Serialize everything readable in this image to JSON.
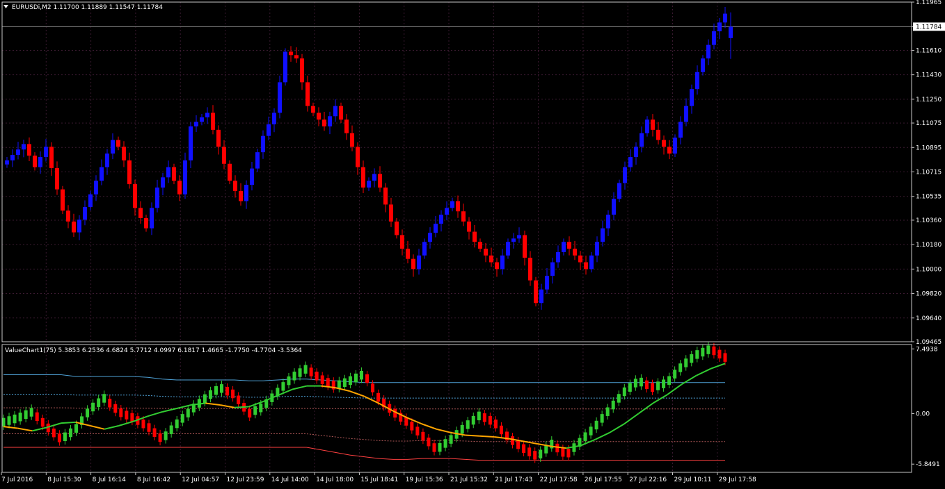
{
  "window": {
    "symbol_header": "EURUSDi,M2  1.11700 1.11889 1.11547 1.11784",
    "menu_icon": "triangle-down-icon"
  },
  "colors": {
    "background": "#000000",
    "grid": "#3a1a30",
    "frame": "#c8c8c8",
    "bull": "#1010ff",
    "bear": "#ff0000",
    "price_line": "#808080",
    "osc_bull": "#32cd32",
    "osc_bear": "#ff0000",
    "ma_up": "#32cd32",
    "ma_down": "#ffa500",
    "upper_band": "#4fa3d8",
    "lower_band": "#ff4040",
    "mid_band": "#b05858"
  },
  "chart_data": [
    {
      "type": "candlestick",
      "title": "EURUSDi,M2  1.11700 1.11889 1.11547 1.11784",
      "y_ticks": [
        "1.11965",
        "1.11784",
        "1.11610",
        "1.11430",
        "1.11250",
        "1.11075",
        "1.10895",
        "1.10715",
        "1.10535",
        "1.10360",
        "1.10180",
        "1.10000",
        "1.09820",
        "1.09640",
        "1.09465"
      ],
      "ylim": [
        1.09465,
        1.11965
      ],
      "current_price": "1.11784",
      "ohlc": {
        "open": 1.117,
        "high": 1.11889,
        "low": 1.11547,
        "close": 1.11784
      },
      "close_path": [
        [
          0,
          1.108
        ],
        [
          3,
          1.1092
        ],
        [
          5,
          1.1075
        ],
        [
          7,
          1.109
        ],
        [
          10,
          1.1043
        ],
        [
          12,
          1.1027
        ],
        [
          15,
          1.1055
        ],
        [
          19,
          1.1095
        ],
        [
          20,
          1.109
        ],
        [
          21,
          1.108
        ],
        [
          23,
          1.1045
        ],
        [
          25,
          1.103
        ],
        [
          27,
          1.106
        ],
        [
          29,
          1.1075
        ],
        [
          31,
          1.1055
        ],
        [
          33,
          1.1105
        ],
        [
          36,
          1.1115
        ],
        [
          38,
          1.109
        ],
        [
          40,
          1.1065
        ],
        [
          42,
          1.105
        ],
        [
          46,
          1.1098
        ],
        [
          48,
          1.1115
        ],
        [
          50,
          1.116
        ],
        [
          52,
          1.1155
        ],
        [
          54,
          1.112
        ],
        [
          57,
          1.1105
        ],
        [
          59,
          1.112
        ],
        [
          62,
          1.109
        ],
        [
          64,
          1.106
        ],
        [
          66,
          1.107
        ],
        [
          67,
          1.106
        ],
        [
          69,
          1.1035
        ],
        [
          71,
          1.1015
        ],
        [
          73,
          1.1
        ],
        [
          75,
          1.102
        ],
        [
          78,
          1.104
        ],
        [
          80,
          1.105
        ],
        [
          82,
          1.1035
        ],
        [
          84,
          1.102
        ],
        [
          86,
          1.101
        ],
        [
          88,
          1.1
        ],
        [
          90,
          1.102
        ],
        [
          92,
          1.1025
        ],
        [
          95,
          1.0975
        ],
        [
          98,
          1.1005
        ],
        [
          100,
          1.102
        ],
        [
          102,
          1.101
        ],
        [
          104,
          1.1
        ],
        [
          106,
          1.102
        ],
        [
          108,
          1.104
        ],
        [
          111,
          1.1075
        ],
        [
          113,
          1.109
        ],
        [
          115,
          1.111
        ],
        [
          117,
          1.1095
        ],
        [
          119,
          1.1085
        ],
        [
          122,
          1.112
        ],
        [
          124,
          1.1145
        ],
        [
          127,
          1.1175
        ],
        [
          129,
          1.1188
        ],
        [
          130,
          1.1178
        ]
      ],
      "n_candles": 131
    },
    {
      "type": "line",
      "title": "ValueChart1(75) 5.3853 6.2536 4.6824 5.7712 4.0997 6.1817 1.4665 -1.7750 -4.7704 -3.5364",
      "y_ticks": [
        "7.4938",
        "0.00",
        "-5.8491"
      ],
      "ylim": [
        -6.8,
        8.0
      ],
      "series": [
        {
          "values": [
            -1.0,
            -0.5,
            0.2,
            -1.5,
            -3.0,
            -1.8,
            0.5,
            1.8,
            0.2,
            -0.5,
            -1.5,
            -3.0,
            -1.2,
            0.4,
            1.8,
            3.0,
            2.2,
            0.0,
            0.8,
            2.5,
            4.2,
            5.2,
            4.0,
            3.2,
            3.8,
            4.6,
            1.8,
            0.2,
            -1.0,
            -2.5,
            -4.2,
            -3.0,
            -1.5,
            -0.2,
            -1.0,
            -2.8,
            -4.0,
            -5.0,
            -3.5,
            -4.8,
            -3.2,
            -1.5,
            0.5,
            2.5,
            3.8,
            3.0,
            3.6,
            5.5,
            6.8,
            7.5,
            6.5
          ]
        },
        {
          "values": [
            -1.5,
            -1.7,
            -2.0,
            -1.6,
            -1.1,
            -1.0,
            -1.4,
            -1.8,
            -1.4,
            -0.9,
            -0.3,
            0.2,
            0.6,
            1.0,
            1.2,
            1.0,
            0.7,
            0.8,
            1.4,
            2.1,
            2.8,
            3.2,
            3.2,
            3.0,
            2.6,
            2.0,
            1.2,
            0.3,
            -0.5,
            -1.2,
            -1.8,
            -2.2,
            -2.5,
            -2.6,
            -2.7,
            -2.9,
            -3.2,
            -3.5,
            -3.8,
            -4.0,
            -3.7,
            -3.0,
            -2.2,
            -1.2,
            0.0,
            1.2,
            2.2,
            3.4,
            4.4,
            5.2,
            5.8
          ]
        },
        {
          "values": [
            4.5,
            4.5,
            4.5,
            4.5,
            4.5,
            4.3,
            4.3,
            4.3,
            4.3,
            4.3,
            4.2,
            4.0,
            3.9,
            3.9,
            3.9,
            3.9,
            3.9,
            3.8,
            3.8,
            3.9,
            4.0,
            4.0,
            3.9,
            3.8,
            3.7,
            3.6,
            3.6,
            3.6,
            3.6,
            3.6,
            3.6,
            3.6,
            3.6,
            3.6,
            3.6,
            3.6,
            3.6,
            3.6,
            3.6,
            3.6,
            3.6,
            3.6,
            3.6,
            3.6,
            3.6,
            3.6,
            3.6,
            3.6,
            3.6,
            3.6,
            3.6
          ]
        },
        {
          "values": [
            -3.9,
            -3.9,
            -3.9,
            -3.9,
            -3.9,
            -3.9,
            -3.9,
            -3.9,
            -3.9,
            -3.9,
            -3.9,
            -3.9,
            -3.9,
            -3.9,
            -3.9,
            -3.9,
            -3.9,
            -3.9,
            -3.9,
            -3.9,
            -3.9,
            -3.9,
            -4.2,
            -4.5,
            -4.8,
            -5.0,
            -5.2,
            -5.3,
            -5.3,
            -5.2,
            -5.2,
            -5.2,
            -5.3,
            -5.4,
            -5.4,
            -5.4,
            -5.4,
            -5.4,
            -5.4,
            -5.4,
            -5.4,
            -5.4,
            -5.4,
            -5.4,
            -5.4,
            -5.4,
            -5.4,
            -5.4,
            -5.4,
            -5.4,
            -5.4
          ]
        }
      ]
    }
  ],
  "x_axis": {
    "labels": [
      "7 Jul 2016",
      "8 Jul 15:30",
      "8 Jul 16:14",
      "8 Jul 16:42",
      "12 Jul 04:57",
      "12 Jul 23:59",
      "14 Jul 14:00",
      "14 Jul 18:00",
      "15 Jul 18:41",
      "19 Jul 15:36",
      "21 Jul 15:32",
      "21 Jul 17:43",
      "22 Jul 17:58",
      "26 Jul 17:55",
      "27 Jul 22:16",
      "29 Jul 10:11",
      "29 Jul 17:58"
    ]
  }
}
